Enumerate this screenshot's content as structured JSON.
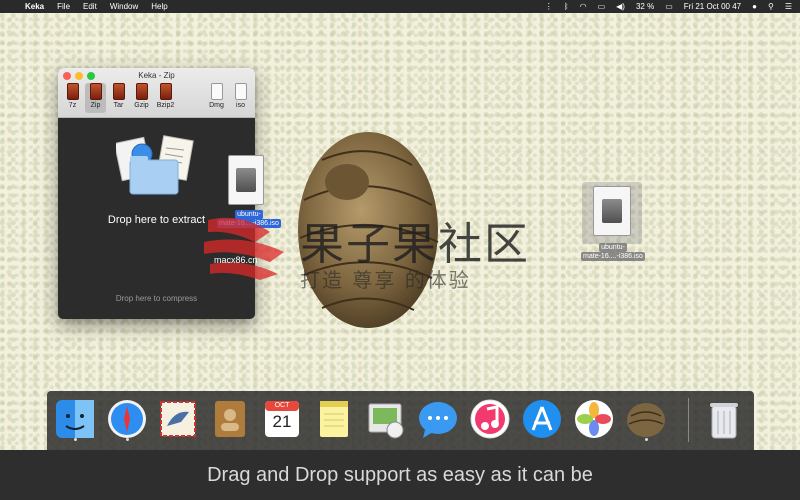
{
  "menubar": {
    "app_name": "Keka",
    "menus": [
      "File",
      "Edit",
      "Window",
      "Help"
    ],
    "battery": "32 %",
    "datetime": "Fri 21 Oct  00 47"
  },
  "keka_window": {
    "title": "Keka - Zip",
    "formats": [
      "7z",
      "Zip",
      "Tar",
      "Gzip",
      "Bzip2",
      "Dmg",
      "iso"
    ],
    "selected_format": "Zip",
    "drop_extract": "Drop here to extract",
    "drop_compress": "Drop here to compress"
  },
  "dragged_file": {
    "line1": "ubuntu-",
    "line2": "mate-16....-i386.iso"
  },
  "desktop_file": {
    "line1": "ubuntu-",
    "line2": "mate-16....-i386.iso"
  },
  "watermark": {
    "big": "果子果社区",
    "small": "打造 尊享  的体验",
    "mark": "macx86.cn"
  },
  "dock": {
    "items": [
      "finder-icon",
      "safari-icon",
      "mail-icon",
      "contacts-icon",
      "calendar-icon",
      "notes-icon",
      "preview-icon",
      "messages-icon",
      "itunes-icon",
      "app-store-icon",
      "photos-icon",
      "keka-icon",
      "trash-icon"
    ],
    "calendar_month": "OCT",
    "calendar_day": "21"
  },
  "caption": "Drag and Drop support as easy as it can be"
}
